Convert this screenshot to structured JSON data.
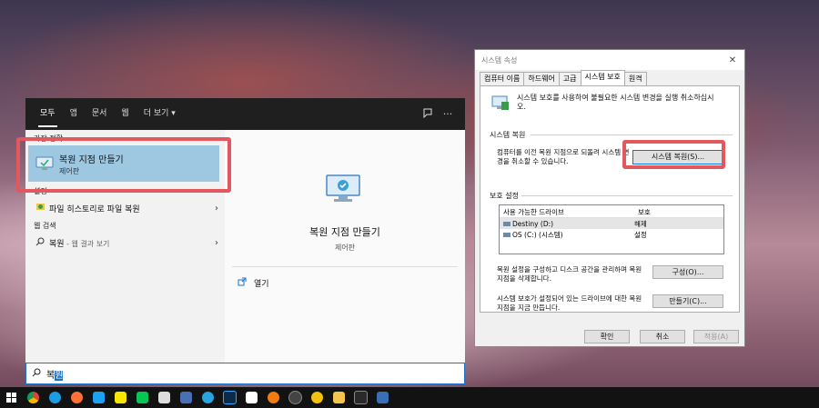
{
  "search": {
    "tabs": [
      "모두",
      "앱",
      "문서",
      "웹",
      "더 보기 ▾"
    ],
    "best_match_label": "가장 정확",
    "best_match_title": "복원 지점 만들기",
    "best_match_sub": "제어판",
    "settings_label": "설정",
    "settings_item": "파일 히스토리로 파일 복원",
    "web_label": "웹 검색",
    "web_item": "복원",
    "web_item_sub": " - 웹 결과 보기",
    "detail_title": "복원 지점 만들기",
    "detail_sub": "제어판",
    "open_label": "열기",
    "query_prefix": "복",
    "query_sel": "원"
  },
  "dialog": {
    "title": "시스템 속성",
    "close": "✕",
    "tabs": [
      "컴퓨터 이름",
      "하드웨어",
      "고급",
      "시스템 보호",
      "원격"
    ],
    "intro": "시스템 보호를 사용하여 불필요한 시스템 변경을 실행 취소하십시오.",
    "restore_group": "시스템 복원",
    "restore_text": "컴퓨터를 이전 복원 지점으로 되돌려 시스템 변경을 취소할 수 있습니다.",
    "restore_button": "시스템 복원(S)...",
    "protect_group": "보호 설정",
    "col_drive": "사용 가능한 드라이브",
    "col_protect": "보호",
    "drives": [
      {
        "name": "Destiny (D:)",
        "state": "해제"
      },
      {
        "name": "OS (C:) (시스템)",
        "state": "설정"
      }
    ],
    "config_text": "복원 설정을 구성하고 디스크 공간을 관리하며 복원 지점을 삭제합니다.",
    "config_button": "구성(O)...",
    "create_text": "시스템 보호가 설정되어 있는 드라이브에 대한 복원 지점을 지금 만듭니다.",
    "create_button": "만들기(C)...",
    "ok": "확인",
    "cancel": "취소",
    "apply": "적용(A)"
  },
  "colors": {
    "highlight": "#e4575f",
    "accent": "#0078d7"
  }
}
